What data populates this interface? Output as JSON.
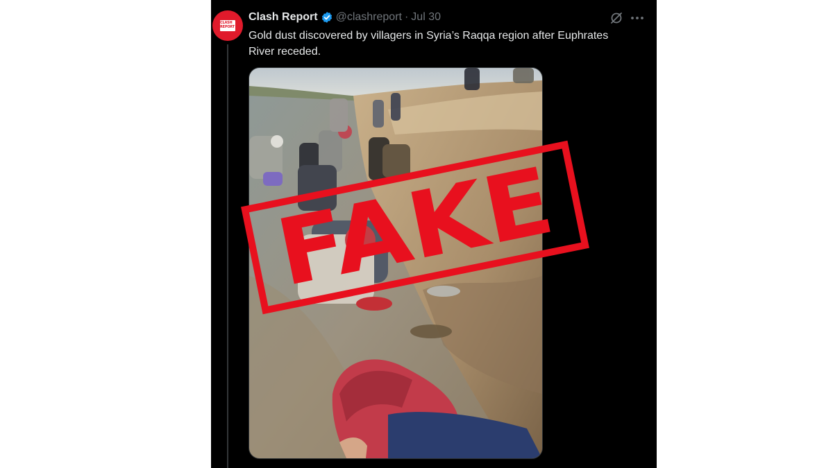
{
  "tweet": {
    "author_name": "Clash Report",
    "handle": "@clashreport",
    "separator": "·",
    "date": "Jul 30",
    "text_lines": [
      "Gold dust discovered by villagers in Syria’s Raqqa region after Euphrates",
      "River receded."
    ],
    "avatar_logo_lines": [
      "CLASH",
      "REPORT"
    ],
    "icons": {
      "verified": "verified-badge-icon",
      "grok": "grok-icon",
      "more": "more-icon"
    }
  },
  "overlay": {
    "stamp_text": "FAKE"
  },
  "colors": {
    "background_frame": "#000000",
    "text_primary": "#e7e9ea",
    "text_secondary": "#71767b",
    "verified_blue": "#1d9bf0",
    "avatar_red": "#e01a2b",
    "stamp_red": "#e8101e"
  }
}
